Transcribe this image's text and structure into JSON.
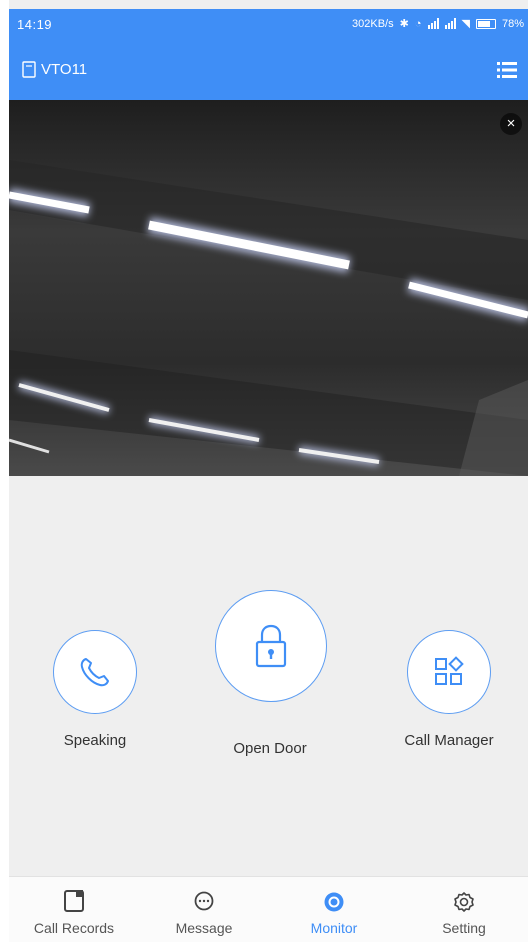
{
  "status": {
    "time": "14:19",
    "net_speed": "302KB/s",
    "battery": "78%"
  },
  "header": {
    "title": "VTO11"
  },
  "video": {
    "close_symbol": "×"
  },
  "controls": {
    "speaking": "Speaking",
    "open_door": "Open Door",
    "call_manager": "Call Manager"
  },
  "nav": {
    "items": [
      {
        "label": "Call Records",
        "icon": "call-records-icon"
      },
      {
        "label": "Message",
        "icon": "message-icon"
      },
      {
        "label": "Monitor",
        "icon": "monitor-icon",
        "active": true
      },
      {
        "label": "Setting",
        "icon": "setting-icon"
      }
    ]
  },
  "colors": {
    "accent": "#3f8ef6",
    "ring": "#5d9df2"
  }
}
